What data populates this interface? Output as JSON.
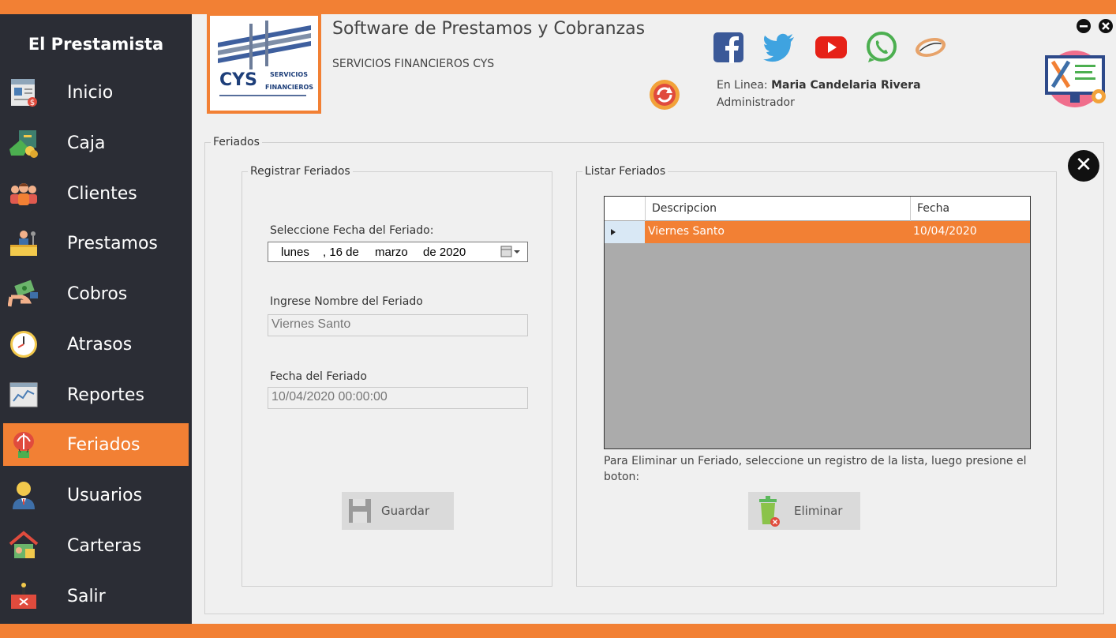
{
  "app": {
    "name": "El Prestamista",
    "subtitle": "Software de Prestamos y Cobranzas",
    "company": "SERVICIOS FINANCIEROS  CYS",
    "logo_text": "CYS",
    "logo_subtext": [
      "SERVICIOS",
      "FINANCIEROS"
    ]
  },
  "colors": {
    "accent": "#F28034",
    "sidebar": "#2B2D35",
    "panel": "#F0F0F0",
    "grid_bg": "#ABABAB"
  },
  "sidebar": {
    "items": [
      {
        "label": "Inicio",
        "icon": "invoice-icon"
      },
      {
        "label": "Caja",
        "icon": "cash-box-icon"
      },
      {
        "label": "Clientes",
        "icon": "clients-icon"
      },
      {
        "label": "Prestamos",
        "icon": "loan-desk-icon"
      },
      {
        "label": "Cobros",
        "icon": "money-hand-icon"
      },
      {
        "label": "Atrasos",
        "icon": "clock-icon"
      },
      {
        "label": "Reportes",
        "icon": "report-chart-icon"
      },
      {
        "label": "Feriados",
        "icon": "holiday-icon",
        "active": true
      },
      {
        "label": "Usuarios",
        "icon": "user-icon"
      },
      {
        "label": "Carteras",
        "icon": "portfolio-house-icon"
      },
      {
        "label": "Salir",
        "icon": "exit-icon"
      }
    ]
  },
  "header": {
    "online_label": "En Linea:",
    "online_user": "Maria Candelaria Rivera",
    "role": "Administrador",
    "social": [
      "facebook-icon",
      "twitter-icon",
      "youtube-icon",
      "whatsapp-icon",
      "mouse-icon"
    ]
  },
  "feriados": {
    "title": "Feriados",
    "registrar": {
      "title": "Registrar Feriados",
      "date_label": "Seleccione Fecha del Feriado:",
      "date": {
        "weekday": "lunes",
        "day": ", 16 de",
        "month": "marzo",
        "year": "de 2020"
      },
      "name_label": "Ingrese Nombre del Feriado",
      "name_value": "Viernes Santo",
      "fecha_label": "Fecha del Feriado",
      "fecha_value": "10/04/2020 00:00:00",
      "save_label": "Guardar"
    },
    "listar": {
      "title": "Listar Feriados",
      "columns": [
        "Descripcion",
        "Fecha"
      ],
      "rows": [
        {
          "descripcion": "Viernes Santo",
          "fecha": "10/04/2020"
        }
      ],
      "help_text": "Para Eliminar un Feriado, seleccione un registro de la lista, luego presione el boton:",
      "delete_label": "Eliminar"
    }
  }
}
